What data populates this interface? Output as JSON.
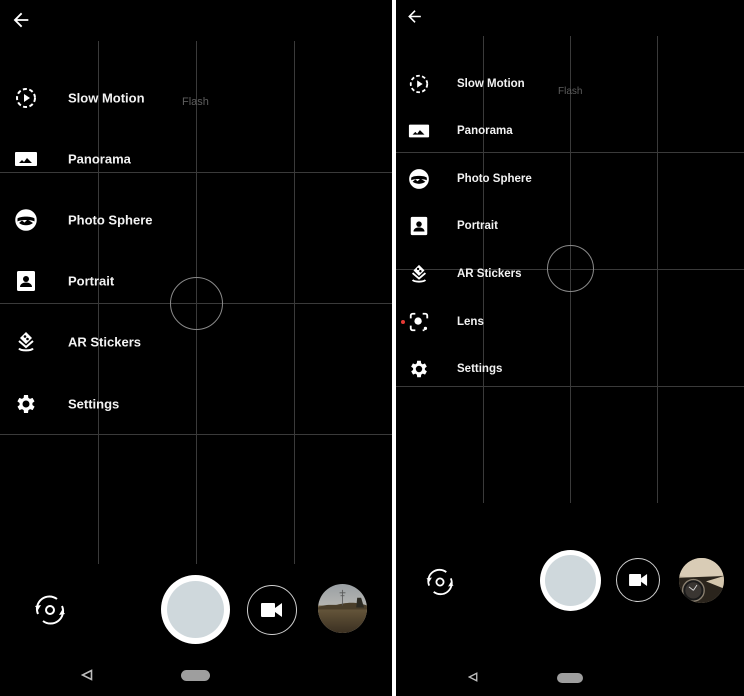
{
  "screens": [
    {
      "id": "left",
      "back_icon": "arrow-left-icon",
      "flash_label": "Flash",
      "menu": [
        {
          "label": "Slow Motion",
          "icon": "slow-motion-icon"
        },
        {
          "label": "Panorama",
          "icon": "panorama-icon"
        },
        {
          "label": "Photo Sphere",
          "icon": "photo-sphere-icon"
        },
        {
          "label": "Portrait",
          "icon": "portrait-icon"
        },
        {
          "label": "AR Stickers",
          "icon": "ar-stickers-icon"
        },
        {
          "label": "Settings",
          "icon": "gear-icon"
        }
      ],
      "controls": {
        "switch_camera_icon": "switch-camera-icon",
        "shutter": "shutter-button",
        "video_icon": "videocam-icon",
        "thumbnail": "gallery-thumbnail (outdoor field with power pylon)"
      },
      "nav": {
        "back_icon": "nav-back-triangle-icon",
        "home": "nav-home-pill"
      }
    },
    {
      "id": "right",
      "back_icon": "arrow-left-icon",
      "flash_label": "Flash",
      "menu": [
        {
          "label": "Slow Motion",
          "icon": "slow-motion-icon"
        },
        {
          "label": "Panorama",
          "icon": "panorama-icon"
        },
        {
          "label": "Photo Sphere",
          "icon": "photo-sphere-icon"
        },
        {
          "label": "Portrait",
          "icon": "portrait-icon"
        },
        {
          "label": "AR Stickers",
          "icon": "ar-stickers-icon"
        },
        {
          "label": "Lens",
          "icon": "lens-icon",
          "new_badge": true
        },
        {
          "label": "Settings",
          "icon": "gear-icon"
        }
      ],
      "controls": {
        "switch_camera_icon": "switch-camera-icon",
        "shutter": "shutter-button",
        "video_icon": "videocam-icon",
        "thumbnail": "gallery-thumbnail (wristwatch)"
      },
      "nav": {
        "back_icon": "nav-back-triangle-icon",
        "home": "nav-home-pill"
      }
    }
  ],
  "colors": {
    "background": "#000000",
    "text": "#f2f2f2",
    "flash_text": "#5e5e5e",
    "grid": "#3a3a3a",
    "shutter_ring": "#ffffff",
    "shutter_fill": "#cfd8dc",
    "new_badge": "#e53935",
    "nav_pill": "#9e9e9e",
    "divider": "#ffffff"
  }
}
